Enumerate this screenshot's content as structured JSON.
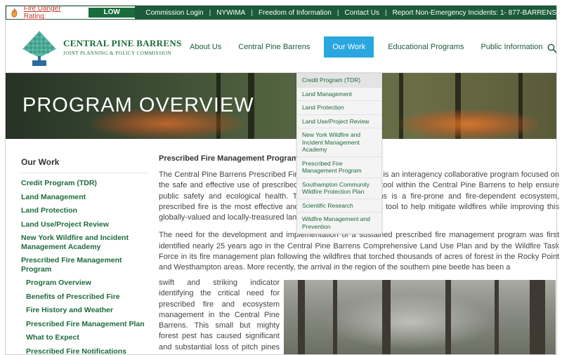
{
  "topbar": {
    "fire_label": "Fire Danger Rating:",
    "fire_level": "LOW",
    "links": [
      "Commission Login",
      "NYWIMA",
      "Freedom of Information",
      "Contact Us",
      "Report Non-Emergency Incidents: 1- 877-BARRENS"
    ],
    "bg_color": "#1c5a3a"
  },
  "header": {
    "logo_line1": "CENTRAL PINE BARRENS",
    "logo_line2": "JOINT PLANNING & POLICY COMMISSION",
    "nav": [
      "About Us",
      "Central Pine Barrens",
      "Our Work",
      "Educational Programs",
      "Public Information"
    ],
    "active_nav": "Our Work",
    "active_color": "#2aa7de",
    "search_icon": "search-icon"
  },
  "hero": {
    "title": "PROGRAM OVERVIEW"
  },
  "dropdown": {
    "items": [
      "Credit Program (TDR)",
      "Land Management",
      "Land Protection",
      "Land Use/Project Review",
      "New York Wildfire and Incident Management Academy",
      "Prescribed Fire Management Program",
      "Southampton Community Wildfire Protection Plan",
      "Scientific Research",
      "Wildfire Management and Prevention"
    ]
  },
  "sidebar": {
    "heading": "Our Work",
    "items": [
      "Credit Program (TDR)",
      "Land Management",
      "Land Protection",
      "Land Use/Project Review",
      "New York Wildfire and Incident Management Academy",
      "Prescribed Fire Management Program"
    ],
    "subitems": [
      "Program Overview",
      "Benefits of Prescribed Fire",
      "Fire History and Weather",
      "Prescribed Fire Management Plan",
      "What to Expect",
      "Prescribed Fire Notifications"
    ]
  },
  "main": {
    "heading": "Prescribed Fire Management Program",
    "para1": "The Central Pine Barrens Prescribed Fire Management Program is an interagency collaborative program focused on the safe and effective use of prescribed fire as a management tool within the Central Pine Barrens to help ensure public safety and ecological health. The Central Pine Barrens is a fire-prone and fire-dependent ecosystem, prescribed fire is the most effective and important management tool to help mitigate wildfires while improving this globally-valued and locally-treasured landscape.",
    "para2": "The need for the development and implementation of a sustained prescribed fire management program was first identified nearly 25 years ago in the Central Pine Barrens Comprehensive Land Use Plan and by the Wildfire Task Force in its fire management plan following the wildfires that torched thousands of acres of forest in the Rocky Point and Westhampton areas.  More recently, the arrival in the region of the southern pine beetle has been a",
    "para3": "swift and striking indicator identifying the critical need for prescribed fire and ecosystem management in the Central Pine Barrens. This small but mighty forest pest has caused significant and substantial loss of pitch pines from forest stands where"
  }
}
